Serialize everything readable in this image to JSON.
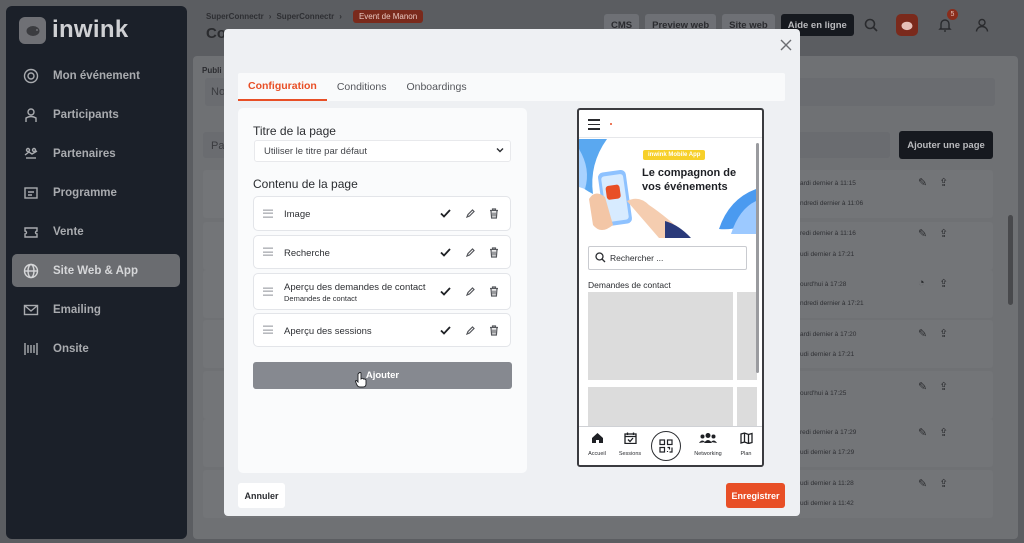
{
  "app": {
    "logo_text": "inwink"
  },
  "sidebar": {
    "items": [
      {
        "label": "Mon événement",
        "icon": "target-icon"
      },
      {
        "label": "Participants",
        "icon": "user-icon"
      },
      {
        "label": "Partenaires",
        "icon": "handshake-icon"
      },
      {
        "label": "Programme",
        "icon": "schedule-icon"
      },
      {
        "label": "Vente",
        "icon": "ticket-icon"
      },
      {
        "label": "Site Web & App",
        "icon": "globe-icon"
      },
      {
        "label": "Emailing",
        "icon": "mail-icon"
      },
      {
        "label": "Onsite",
        "icon": "onsite-icon"
      }
    ]
  },
  "header": {
    "breadcrumb": [
      "SuperConnectr",
      "SuperConnectr"
    ],
    "badge": "Event de Manon",
    "title": "Co",
    "buttons": {
      "cms": "CMS",
      "preview": "Preview web",
      "site": "Site web",
      "help": "Aide en ligne"
    },
    "notif_count": "5"
  },
  "background": {
    "tab": "Publi",
    "field_text": "No",
    "search_text": "Pa",
    "add_page_button": "Ajouter une page",
    "rows": [
      {
        "line1": "ardi dernier à 11:15",
        "line2": "ndredi dernier à 11:06"
      },
      {
        "line1": "redi dernier à 11:16",
        "line2": "udi dernier à 17:21"
      },
      {
        "line1": "ourd'hui à 17:28",
        "line2": "ndredi dernier à 17:21"
      },
      {
        "line1": "ardi dernier à 17:20",
        "line2": "udi dernier à 17:21"
      },
      {
        "line1": "ourd'hui à 17:25",
        "line2": ""
      },
      {
        "line1": "redi dernier à 17:29",
        "line2": "udi dernier à 17:29"
      },
      {
        "line1": "udi dernier à 11:28",
        "line2": "udi dernier à 11:42"
      }
    ]
  },
  "modal": {
    "tabs": [
      "Configuration",
      "Conditions",
      "Onboardings"
    ],
    "page_title_label": "Titre de la page",
    "page_title_select": "Utiliser le titre par défaut",
    "content_label": "Contenu de la page",
    "blocks": [
      {
        "title": "Image",
        "subtitle": ""
      },
      {
        "title": "Recherche",
        "subtitle": ""
      },
      {
        "title": "Aperçu des demandes de contact",
        "subtitle": "Demandes de contact"
      },
      {
        "title": "Aperçu des sessions",
        "subtitle": ""
      }
    ],
    "add_button": "Ajouter",
    "cancel_button": "Annuler",
    "save_button": "Enregistrer"
  },
  "preview": {
    "banner_tag": "inwink Mobile App",
    "banner_title": "Le compagnon de vos événements",
    "search_placeholder": "Rechercher ...",
    "section_title": "Demandes de contact",
    "tabbar": [
      "Accueil",
      "Sessions",
      "",
      "Networking",
      "Plan"
    ]
  },
  "colors": {
    "accent": "#e84f26",
    "sidebar": "#1b2029"
  }
}
